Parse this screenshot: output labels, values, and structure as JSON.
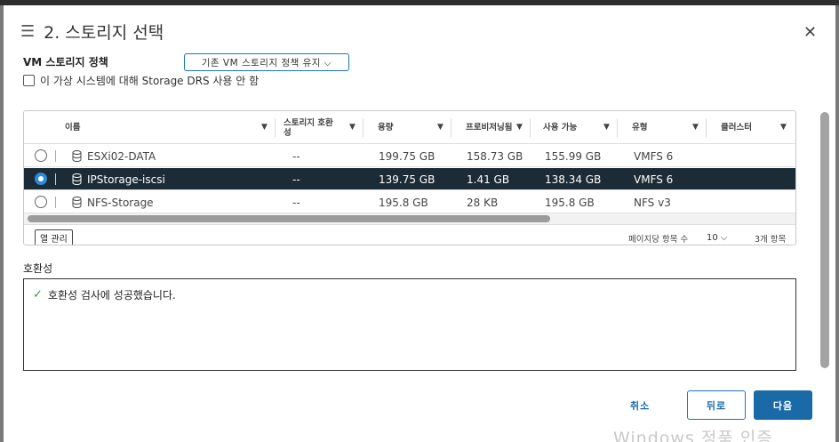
{
  "dialog": {
    "title": "2. 스토리지 선택",
    "menu_icon": "hamburger-icon",
    "close_icon": "close-icon"
  },
  "policy": {
    "label": "VM 스토리지 정책",
    "selected": "기존 VM 스토리지 정책 유지 ⌵"
  },
  "drs": {
    "label": "이 가상 시스템에 대해 Storage DRS 사용 안 함",
    "checked": false
  },
  "table": {
    "headers": [
      "이름",
      "스토리지 호환성",
      "용량",
      "프로비저닝됨",
      "사용 가능",
      "유형",
      "클러스터"
    ],
    "rows": [
      {
        "name": "ESXi02-DATA",
        "compat": "--",
        "capacity": "199.75 GB",
        "provisioned": "158.73 GB",
        "free": "155.99 GB",
        "type": "VMFS 6",
        "cluster": "",
        "selected": false
      },
      {
        "name": "IPStorage-iscsi",
        "compat": "--",
        "capacity": "139.75 GB",
        "provisioned": "1.41 GB",
        "free": "138.34 GB",
        "type": "VMFS 6",
        "cluster": "",
        "selected": true
      },
      {
        "name": "NFS-Storage",
        "compat": "--",
        "capacity": "195.8 GB",
        "provisioned": "28 KB",
        "free": "195.8 GB",
        "type": "NFS v3",
        "cluster": "",
        "selected": false
      }
    ],
    "footer": {
      "column_manager": "열 관리",
      "per_page_label": "페이지당 항목 수",
      "per_page_value": "10 ⌵",
      "count": "3개 항목"
    }
  },
  "compatibility": {
    "label": "호환성",
    "message": "호환성 검사에 성공했습니다."
  },
  "buttons": {
    "cancel": "취소",
    "back": "뒤로",
    "next": "다음"
  },
  "watermark": "Windows 정품 인증"
}
